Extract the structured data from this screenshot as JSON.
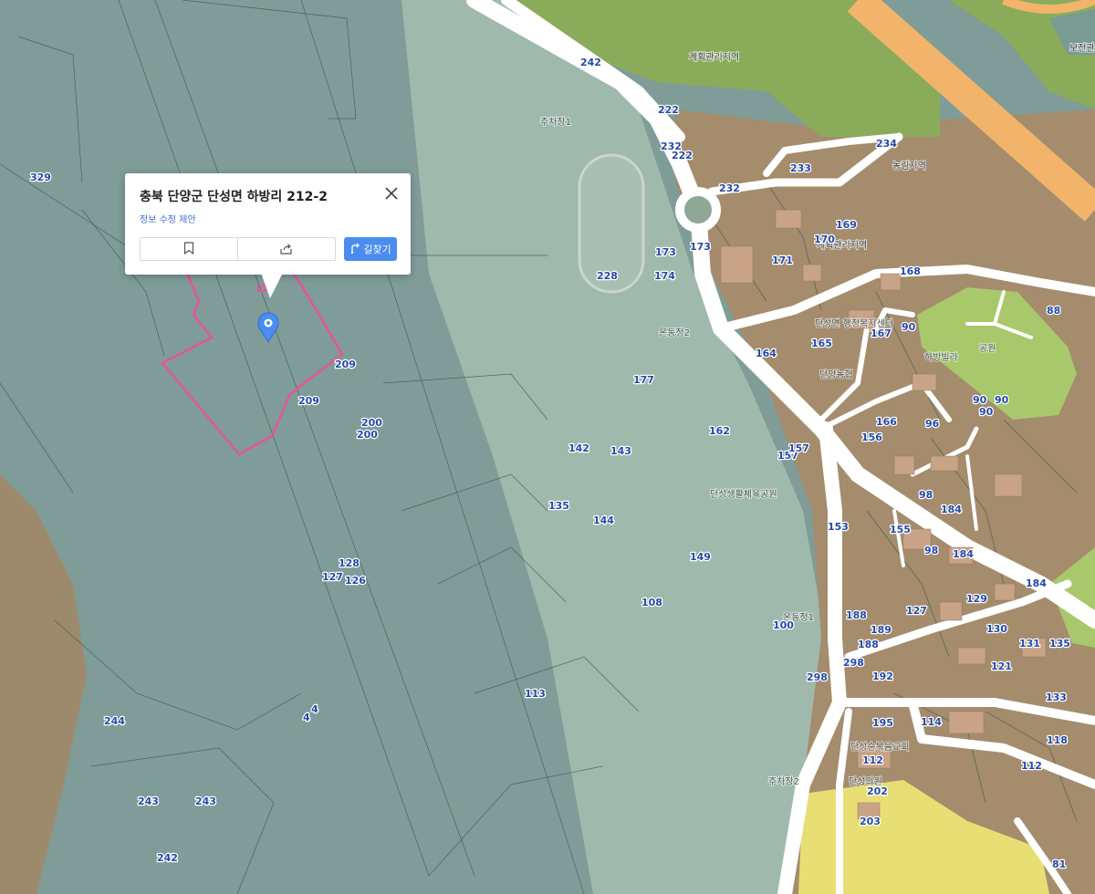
{
  "popup": {
    "address": "충북 단양군 단성면 하방리 212-2",
    "edit_link": "정보 수정 제안",
    "route_label": "길찾기"
  },
  "icons": [
    "bookmark-icon",
    "share-icon",
    "close-icon",
    "route-icon",
    "location-pin-icon"
  ],
  "colors": {
    "river": "#7f9c98",
    "farmland": "#a48c6d",
    "green_zone": "#8aac5a",
    "park": "#a9c76b",
    "expressway": "#f2b46a",
    "yellow_zone": "#e8df74",
    "parcel_highlight": "#e5559a",
    "label_blue": "#2549a8",
    "button_blue": "#4a8cf0"
  },
  "zone_labels": [
    "계획관리지역",
    "농림지역",
    "계획관리지역",
    "보전관리"
  ],
  "poi_labels": [
    "주차장1",
    "단성면 행정복지센터",
    "단양농협",
    "하방빌라",
    "공원",
    "온동정2",
    "단성생활체육공원",
    "온동정1",
    "주차장2",
    "단성순복음교회",
    "단성의원"
  ],
  "parcel_numbers": [
    "242",
    "222",
    "232",
    "222",
    "234",
    "233",
    "232",
    "169",
    "170",
    "173",
    "173",
    "174",
    "228",
    "171",
    "168",
    "88",
    "90",
    "167",
    "165",
    "164",
    "329",
    "209",
    "209",
    "200",
    "200",
    "177",
    "162",
    "142",
    "143",
    "135",
    "144",
    "157",
    "157",
    "166",
    "156",
    "96",
    "90",
    "90",
    "90",
    "98",
    "184",
    "153",
    "155",
    "98",
    "184",
    "184",
    "128",
    "127",
    "126",
    "149",
    "108",
    "129",
    "127",
    "188",
    "189",
    "188",
    "130",
    "131",
    "135",
    "100",
    "298",
    "298",
    "192",
    "121",
    "133",
    "113",
    "244",
    "4",
    "4",
    "195",
    "114",
    "118",
    "112",
    "112",
    "202",
    "203",
    "243",
    "243",
    "242",
    "81"
  ]
}
